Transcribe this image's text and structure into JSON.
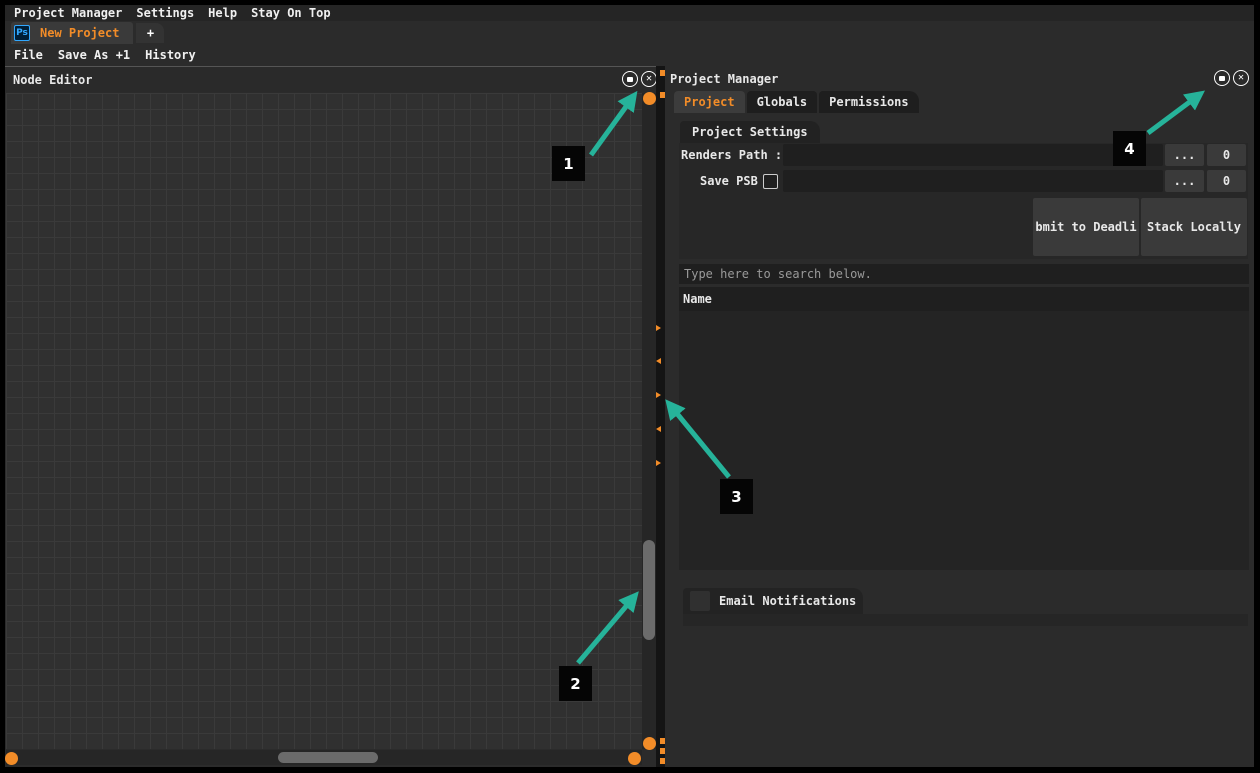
{
  "menu": {
    "items": [
      "Project Manager",
      "Settings",
      "Help",
      "Stay On Top"
    ]
  },
  "tabs": {
    "project_tab_icon": "Ps",
    "project_tab_label": "New Project",
    "add_tab_label": "+"
  },
  "toolbar": {
    "items": [
      "File",
      "Save As +1",
      "History"
    ]
  },
  "node_editor": {
    "title": "Node Editor",
    "restore_icon": "restore-icon",
    "close_icon": "close-icon"
  },
  "project_manager": {
    "title": "Project Manager",
    "tabs": [
      "Project",
      "Globals",
      "Permissions"
    ],
    "active_tab": "Project",
    "subtab": "Project Settings",
    "renders_path_label": "Renders Path :",
    "renders_path_value": "",
    "browse_label": "...",
    "renders_count": "0",
    "save_psb_label": "Save PSB",
    "save_psb_checked": false,
    "psb_value": "",
    "psb_browse_label": "...",
    "psb_count": "0",
    "submit_button": "bmit to Deadli",
    "stack_button": "Stack Locally",
    "search_placeholder": "Type here to search below.",
    "table_header_name": "Name",
    "email_notifications": "Email Notifications"
  },
  "annotations": [
    "1",
    "2",
    "3",
    "4"
  ],
  "colors": {
    "accent": "#f28c28",
    "arrow": "#26b39a",
    "background": "#2b2b2b"
  }
}
